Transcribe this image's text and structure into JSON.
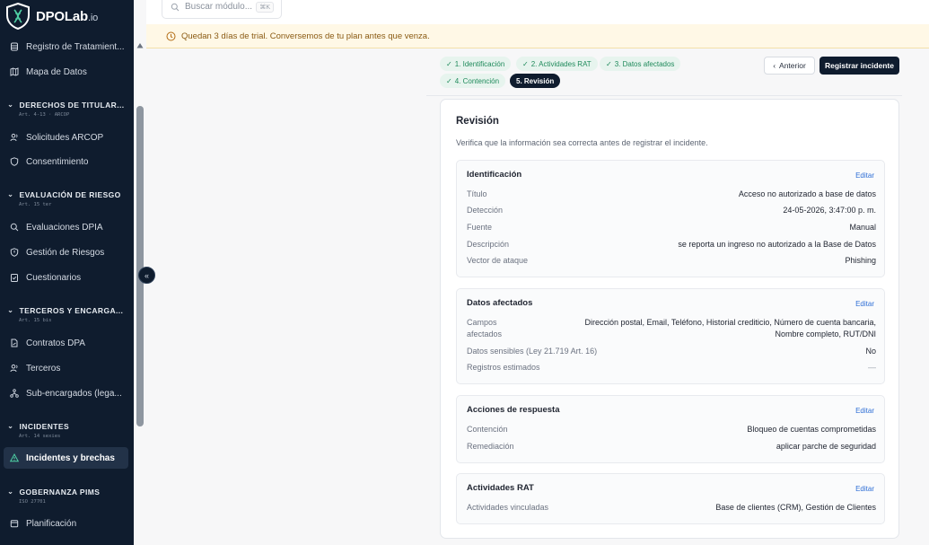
{
  "app": {
    "brand": "DPOLab",
    "brand_suffix": ".io"
  },
  "sidebar": {
    "items": {
      "registro": "Registro de Tratamient...",
      "mapa": "Mapa de Datos",
      "solicitudes": "Solicitudes ARCOP",
      "consentimiento": "Consentimiento",
      "evaluaciones": "Evaluaciones DPIA",
      "riesgos": "Gestión de Riesgos",
      "cuestionarios": "Cuestionarios",
      "contratos": "Contratos DPA",
      "terceros": "Terceros",
      "subencargados": "Sub-encargados (lega...",
      "incidentes": "Incidentes y brechas",
      "planificacion": "Planificación"
    },
    "sections": {
      "derechos": {
        "title": "DERECHOS DE TITULAR...",
        "sub": "Art. 4-13 · ARCOP"
      },
      "evaluacion": {
        "title": "EVALUACIÓN DE RIESGO",
        "sub": "Art. 15 ter"
      },
      "terceros": {
        "title": "TERCEROS Y ENCARGA...",
        "sub": "Art. 15 bis"
      },
      "incidentes": {
        "title": "INCIDENTES",
        "sub": "Art. 14 sexies"
      },
      "gobernanza": {
        "title": "GOBERNANZA PIMS",
        "sub": "ISO 27701"
      }
    }
  },
  "topbar": {
    "search_placeholder": "Buscar módulo...",
    "search_shortcut": "⌘K"
  },
  "trial_banner": "Quedan 3 días de trial. Conversemos de tu plan antes que venza.",
  "steps": [
    {
      "label": "1. Identificación",
      "done": true
    },
    {
      "label": "2. Actividades RAT",
      "done": true
    },
    {
      "label": "3. Datos afectados",
      "done": true
    },
    {
      "label": "4. Contención",
      "done": true
    },
    {
      "label": "5. Revisión",
      "done": false
    }
  ],
  "actions": {
    "prev": "Anterior",
    "register": "Registrar incidente"
  },
  "review": {
    "title": "Revisión",
    "description": "Verifica que la información sea correcta antes de registrar el incidente.",
    "edit_label": "Editar",
    "identificacion": {
      "title": "Identificación",
      "rows": [
        {
          "label": "Título",
          "value": "Acceso no autorizado a base de datos"
        },
        {
          "label": "Detección",
          "value": "24-05-2026, 3:47:00 p. m."
        },
        {
          "label": "Fuente",
          "value": "Manual"
        },
        {
          "label": "Descripción",
          "value": "se reporta un ingreso no autorizado a la Base de Datos"
        },
        {
          "label": "Vector de ataque",
          "value": "Phishing"
        }
      ]
    },
    "datos": {
      "title": "Datos afectados",
      "campos_label_1": "Campos",
      "campos_label_2": "afectados",
      "campos_value_1": "Dirección postal, Email, Teléfono, Historial crediticio, Número de cuenta bancaria,",
      "campos_value_2": "Nombre completo, RUT/DNI",
      "sensibles_label": "Datos sensibles (Ley 21.719 Art. 16)",
      "sensibles_value": "No",
      "registros_label": "Registros estimados",
      "registros_value": "—"
    },
    "acciones": {
      "title": "Acciones de respuesta",
      "rows": [
        {
          "label": "Contención",
          "value": "Bloqueo de cuentas comprometidas"
        },
        {
          "label": "Remediación",
          "value": "aplicar parche de seguridad"
        }
      ]
    },
    "actividades": {
      "title": "Actividades RAT",
      "label": "Actividades vinculadas",
      "value": "Base de clientes (CRM), Gestión de Clientes"
    }
  },
  "colors": {
    "sidebar_bg": "#0f1c2e",
    "accent_green": "#1f8a5b",
    "link_blue": "#2f6fd6",
    "banner_bg": "#fff8e6"
  }
}
